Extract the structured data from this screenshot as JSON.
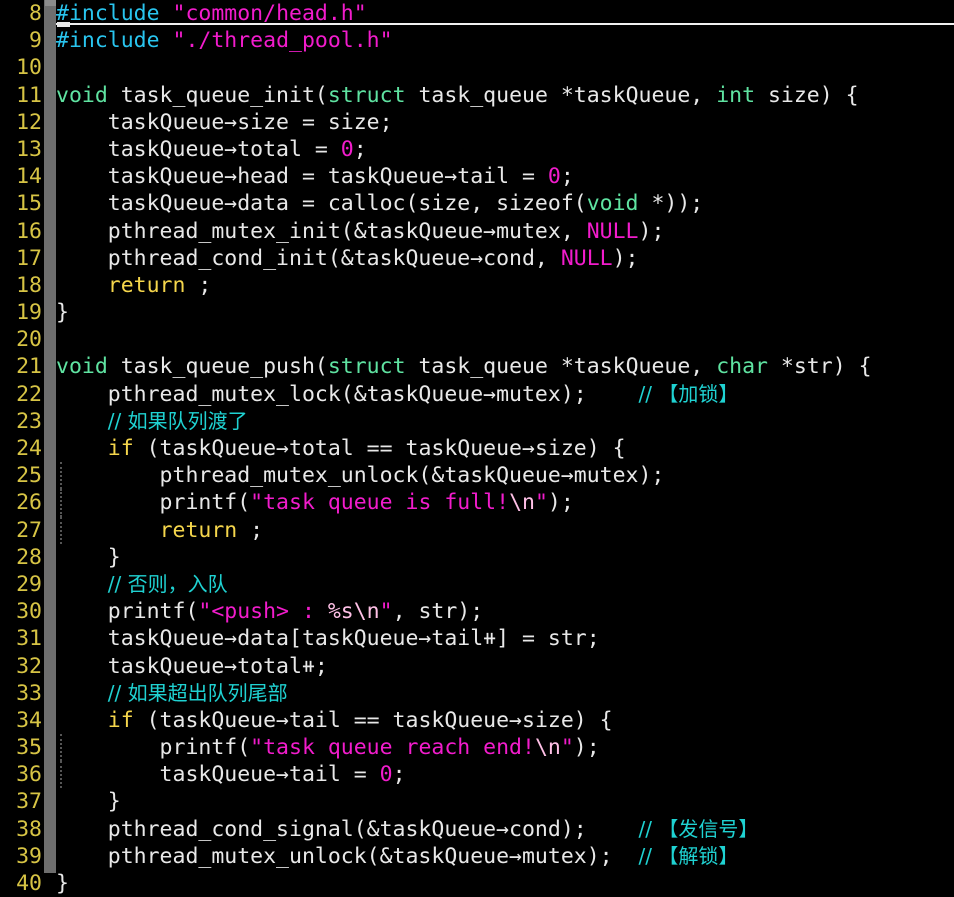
{
  "app": {
    "kind": "terminal-code-editor",
    "language": "C",
    "theme": {
      "background": "#000000",
      "foreground": "#e8e8e8",
      "line_number": "#d7c445",
      "keyword": "#f5d64c",
      "type": "#5fe3a1",
      "preprocessor": "#29c5ef",
      "string": "#f21ccc",
      "string_escape": "#ffc0e6",
      "number": "#f21ccc",
      "comment": "#1fd2d2",
      "scrollbar": "#6e6e6e",
      "scrollbar_thumb": "#8c8c8c",
      "cursorline_underline": "#f0f0f0"
    }
  },
  "scrollbar": {
    "name": "vertical-scrollbar",
    "thumb_top_percent": 0,
    "thumb_height_percent": 98
  },
  "cursor": {
    "line": 8,
    "column": 1
  },
  "editor": {
    "first_visible_line": 8,
    "last_visible_line": 40,
    "lines": [
      {
        "n": "8",
        "cursorline": true,
        "tokens": [
          {
            "t": "#include",
            "c": "pre"
          },
          {
            "t": " ",
            "c": "op"
          },
          {
            "t": "\"common/head.h\"",
            "c": "str"
          }
        ]
      },
      {
        "n": "9",
        "tokens": [
          {
            "t": "#include",
            "c": "pre"
          },
          {
            "t": " ",
            "c": "op"
          },
          {
            "t": "\"./thread_pool.h\"",
            "c": "str"
          }
        ]
      },
      {
        "n": "10",
        "tokens": []
      },
      {
        "n": "11",
        "tokens": [
          {
            "t": "void",
            "c": "type"
          },
          {
            "t": " task_queue_init(",
            "c": "id"
          },
          {
            "t": "struct",
            "c": "type"
          },
          {
            "t": " task_queue *taskQueue, ",
            "c": "id"
          },
          {
            "t": "int",
            "c": "type"
          },
          {
            "t": " size) {",
            "c": "id"
          }
        ]
      },
      {
        "n": "12",
        "tokens": [
          {
            "t": "    taskQueue→size = size;",
            "c": "id"
          }
        ]
      },
      {
        "n": "13",
        "tokens": [
          {
            "t": "    taskQueue→total = ",
            "c": "id"
          },
          {
            "t": "0",
            "c": "num"
          },
          {
            "t": ";",
            "c": "id"
          }
        ]
      },
      {
        "n": "14",
        "tokens": [
          {
            "t": "    taskQueue→head = taskQueue→tail = ",
            "c": "id"
          },
          {
            "t": "0",
            "c": "num"
          },
          {
            "t": ";",
            "c": "id"
          }
        ]
      },
      {
        "n": "15",
        "tokens": [
          {
            "t": "    taskQueue→data = calloc(size, sizeof(",
            "c": "id"
          },
          {
            "t": "void",
            "c": "type"
          },
          {
            "t": " *));",
            "c": "id"
          }
        ]
      },
      {
        "n": "16",
        "tokens": [
          {
            "t": "    pthread_mutex_init(&taskQueue→mutex, ",
            "c": "id"
          },
          {
            "t": "NULL",
            "c": "num"
          },
          {
            "t": ");",
            "c": "id"
          }
        ]
      },
      {
        "n": "17",
        "tokens": [
          {
            "t": "    pthread_cond_init(&taskQueue→cond, ",
            "c": "id"
          },
          {
            "t": "NULL",
            "c": "num"
          },
          {
            "t": ");",
            "c": "id"
          }
        ]
      },
      {
        "n": "18",
        "tokens": [
          {
            "t": "    ",
            "c": "id"
          },
          {
            "t": "return",
            "c": "kw"
          },
          {
            "t": " ;",
            "c": "id"
          }
        ]
      },
      {
        "n": "19",
        "tokens": [
          {
            "t": "}",
            "c": "id"
          }
        ]
      },
      {
        "n": "20",
        "tokens": []
      },
      {
        "n": "21",
        "tokens": [
          {
            "t": "void",
            "c": "type"
          },
          {
            "t": " task_queue_push(",
            "c": "id"
          },
          {
            "t": "struct",
            "c": "type"
          },
          {
            "t": " task_queue *taskQueue, ",
            "c": "id"
          },
          {
            "t": "char",
            "c": "type"
          },
          {
            "t": " *str) {",
            "c": "id"
          }
        ]
      },
      {
        "n": "22",
        "tokens": [
          {
            "t": "    pthread_mutex_lock(&taskQueue→mutex);    ",
            "c": "id"
          },
          {
            "t": "// 【加锁】",
            "c": "cmt"
          }
        ]
      },
      {
        "n": "23",
        "tokens": [
          {
            "t": "    ",
            "c": "id"
          },
          {
            "t": "// 如果队列渡了",
            "c": "cmt"
          }
        ]
      },
      {
        "n": "24",
        "tokens": [
          {
            "t": "    ",
            "c": "id"
          },
          {
            "t": "if",
            "c": "kw"
          },
          {
            "t": " (taskQueue→total == taskQueue→size) {",
            "c": "id"
          }
        ]
      },
      {
        "n": "25",
        "indent_guide": true,
        "tokens": [
          {
            "t": "        pthread_mutex_unlock(&taskQueue→mutex);",
            "c": "id"
          }
        ]
      },
      {
        "n": "26",
        "indent_guide": true,
        "tokens": [
          {
            "t": "        printf(",
            "c": "id"
          },
          {
            "t": "\"task queue is full!",
            "c": "str"
          },
          {
            "t": "\\n",
            "c": "esc"
          },
          {
            "t": "\"",
            "c": "str"
          },
          {
            "t": ");",
            "c": "id"
          }
        ]
      },
      {
        "n": "27",
        "indent_guide": true,
        "tokens": [
          {
            "t": "        ",
            "c": "id"
          },
          {
            "t": "return",
            "c": "kw"
          },
          {
            "t": " ;",
            "c": "id"
          }
        ]
      },
      {
        "n": "28",
        "tokens": [
          {
            "t": "    }",
            "c": "id"
          }
        ]
      },
      {
        "n": "29",
        "tokens": [
          {
            "t": "    ",
            "c": "id"
          },
          {
            "t": "// 否则，入队",
            "c": "cmt"
          }
        ]
      },
      {
        "n": "30",
        "tokens": [
          {
            "t": "    printf(",
            "c": "id"
          },
          {
            "t": "\"<push> : ",
            "c": "str"
          },
          {
            "t": "%s",
            "c": "esc"
          },
          {
            "t": "\\n",
            "c": "esc"
          },
          {
            "t": "\"",
            "c": "str"
          },
          {
            "t": ", str);",
            "c": "id"
          }
        ]
      },
      {
        "n": "31",
        "tokens": [
          {
            "t": "    taskQueue→data[taskQueue→tail⧺] = str;",
            "c": "id"
          }
        ]
      },
      {
        "n": "32",
        "tokens": [
          {
            "t": "    taskQueue→total⧺;",
            "c": "id"
          }
        ]
      },
      {
        "n": "33",
        "tokens": [
          {
            "t": "    ",
            "c": "id"
          },
          {
            "t": "// 如果超出队列尾部",
            "c": "cmt"
          }
        ]
      },
      {
        "n": "34",
        "tokens": [
          {
            "t": "    ",
            "c": "id"
          },
          {
            "t": "if",
            "c": "kw"
          },
          {
            "t": " (taskQueue→tail == taskQueue→size) {",
            "c": "id"
          }
        ]
      },
      {
        "n": "35",
        "indent_guide": true,
        "tokens": [
          {
            "t": "        printf(",
            "c": "id"
          },
          {
            "t": "\"task queue reach end!",
            "c": "str"
          },
          {
            "t": "\\n",
            "c": "esc"
          },
          {
            "t": "\"",
            "c": "str"
          },
          {
            "t": ");",
            "c": "id"
          }
        ]
      },
      {
        "n": "36",
        "indent_guide": true,
        "tokens": [
          {
            "t": "        taskQueue→tail = ",
            "c": "id"
          },
          {
            "t": "0",
            "c": "num"
          },
          {
            "t": ";",
            "c": "id"
          }
        ]
      },
      {
        "n": "37",
        "tokens": [
          {
            "t": "    }",
            "c": "id"
          }
        ]
      },
      {
        "n": "38",
        "tokens": [
          {
            "t": "    pthread_cond_signal(&taskQueue→cond);    ",
            "c": "id"
          },
          {
            "t": "// 【发信号】",
            "c": "cmt"
          }
        ]
      },
      {
        "n": "39",
        "tokens": [
          {
            "t": "    pthread_mutex_unlock(&taskQueue→mutex);  ",
            "c": "id"
          },
          {
            "t": "// 【解锁】",
            "c": "cmt"
          }
        ]
      },
      {
        "n": "40",
        "tokens": [
          {
            "t": "}",
            "c": "id"
          }
        ]
      }
    ]
  }
}
